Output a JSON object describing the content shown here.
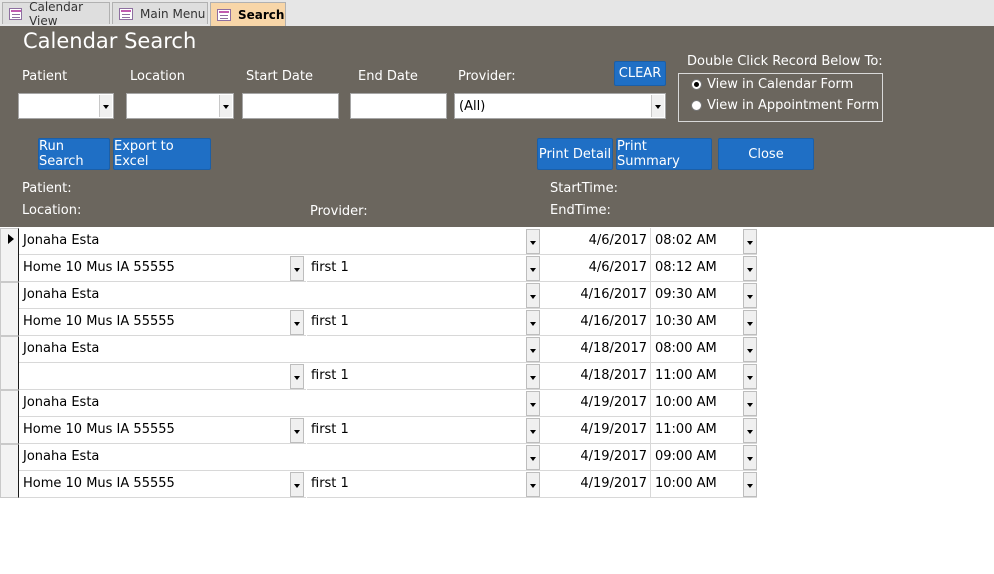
{
  "tabs": [
    {
      "label": "Calendar View",
      "active": false
    },
    {
      "label": "Main Menu",
      "active": false
    },
    {
      "label": "Search",
      "active": true
    }
  ],
  "form": {
    "title": "Calendar Search",
    "filters": {
      "patient_label": "Patient",
      "location_label": "Location",
      "start_date_label": "Start Date",
      "end_date_label": "End Date",
      "provider_label": "Provider:",
      "provider_value": "(All)",
      "patient_value": "",
      "location_value": "",
      "start_date_value": "",
      "end_date_value": ""
    },
    "clear_label": "CLEAR",
    "options": {
      "heading": "Double Click Record Below To:",
      "items": [
        {
          "label": "View in Calendar Form",
          "selected": true
        },
        {
          "label": "View in Appointment Form",
          "selected": false
        }
      ]
    },
    "buttons": {
      "run_search": "Run Search",
      "export_excel": "Export to Excel",
      "print_detail": "Print Detail",
      "print_summary": "Print Summary",
      "close": "Close"
    },
    "column_labels": {
      "patient": "Patient:",
      "location": "Location:",
      "provider": "Provider:",
      "start_time": "StartTime:",
      "end_time": "EndTime:"
    }
  },
  "records": [
    {
      "patient": "Jonaha Esta",
      "location": "Home 10  Mus IA 55555",
      "provider": "first 1",
      "start_date": "4/6/2017",
      "start_time": "08:02 AM",
      "end_date": "4/6/2017",
      "end_time": "08:12 AM"
    },
    {
      "patient": "Jonaha Esta",
      "location": "Home 10  Mus IA 55555",
      "provider": "first 1",
      "start_date": "4/16/2017",
      "start_time": "09:30 AM",
      "end_date": "4/16/2017",
      "end_time": "10:30 AM"
    },
    {
      "patient": "Jonaha Esta",
      "location": "",
      "provider": "first 1",
      "start_date": "4/18/2017",
      "start_time": "08:00 AM",
      "end_date": "4/18/2017",
      "end_time": "11:00 AM"
    },
    {
      "patient": "Jonaha Esta",
      "location": "Home 10  Mus IA 55555",
      "provider": "first 1",
      "start_date": "4/19/2017",
      "start_time": "10:00 AM",
      "end_date": "4/19/2017",
      "end_time": "11:00 AM"
    },
    {
      "patient": "Jonaha Esta",
      "location": "Home 10  Mus IA 55555",
      "provider": "first 1",
      "start_date": "4/19/2017",
      "start_time": "09:00 AM",
      "end_date": "4/19/2017",
      "end_time": "10:00 AM"
    }
  ]
}
